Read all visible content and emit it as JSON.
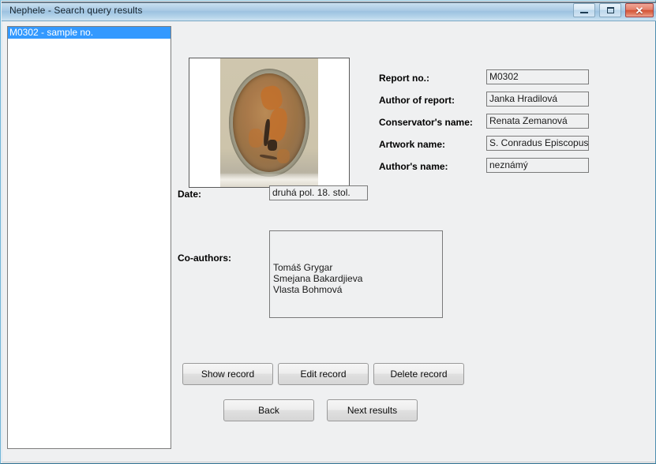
{
  "window": {
    "title": "Nephele - Search query results",
    "controls": {
      "minimize_label": "Minimize",
      "maximize_label": "Maximize",
      "close_label": "Close",
      "close_glyph": "✕"
    },
    "accent_color": "#3399ff",
    "titlebar_color": "#a8c9e4",
    "close_button_color": "#d35336"
  },
  "results_list": {
    "items": [
      {
        "label": "M0302 - sample no.",
        "selected": true
      }
    ]
  },
  "thumbnail": {
    "alt": "Photograph of an oval painting panel with damaged, corroded surface"
  },
  "record": {
    "fields": [
      {
        "label": "Report no.:",
        "value": "M0302"
      },
      {
        "label": "Author of report:",
        "value": "Janka Hradilová"
      },
      {
        "label": "Conservator's name:",
        "value": "Renata Zemanová"
      },
      {
        "label": "Artwork name:",
        "value": "S. Conradus Episcopus"
      },
      {
        "label": "Author's name:",
        "value": "neznámý"
      }
    ],
    "date": {
      "label": "Date:",
      "value": "druhá pol. 18. stol."
    },
    "coauthors": {
      "label": "Co-authors:",
      "value": "Tomáš Grygar\nSmejana Bakardjieva\nVlasta Bohmová"
    }
  },
  "actions": {
    "show_record": "Show record",
    "edit_record": "Edit record",
    "delete_record": "Delete record",
    "back": "Back",
    "next_results": "Next results"
  }
}
